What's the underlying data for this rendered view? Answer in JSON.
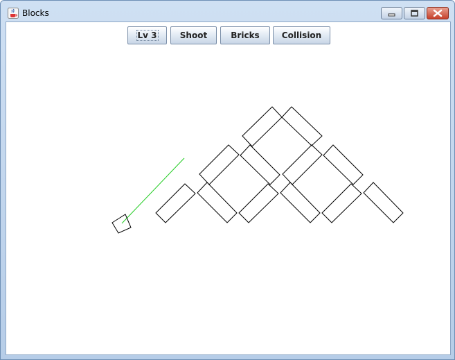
{
  "window": {
    "title": "Blocks",
    "app_icon": "java-cup-icon",
    "controls": [
      "minimize-icon",
      "maximize-icon",
      "close-icon"
    ],
    "accent": "#b6cde8",
    "close_color": "#c7402a"
  },
  "toolbar": {
    "buttons": [
      {
        "label": "Lv 3",
        "focused": true
      },
      {
        "label": "Shoot"
      },
      {
        "label": "Bricks"
      },
      {
        "label": "Collision"
      }
    ]
  },
  "game": {
    "brick_stroke": "#000000",
    "aim_line_color": "#22cc22",
    "brick_count": 13,
    "brick_orientation": "diagonal"
  }
}
